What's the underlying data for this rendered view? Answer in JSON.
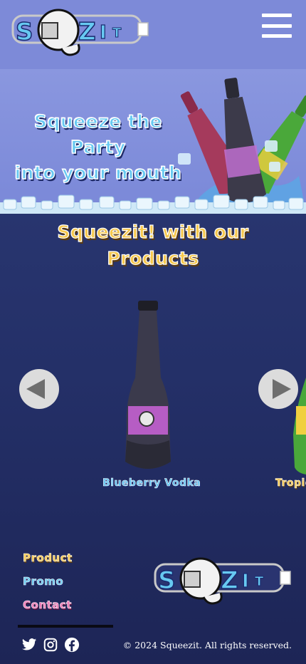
{
  "brand": {
    "logo_text": "SQZIT",
    "logo_icon": "squeeze-fist-bottle-logo"
  },
  "header": {
    "menu_icon": "hamburger-menu-icon"
  },
  "hero": {
    "title_line1": "Squeeze the Party",
    "title_line2": "into your mouth"
  },
  "products": {
    "title_line1": "Squeezit! with our",
    "title_line2": "Products",
    "items": [
      {
        "name": "Blueberry Vodka",
        "color": "#3a3240"
      },
      {
        "name": "Tropic",
        "color": "#3e8a2a"
      }
    ],
    "prev_icon": "arrow-left-icon",
    "next_icon": "arrow-right-icon"
  },
  "footer": {
    "links": {
      "product": "Product",
      "promo": "Promo",
      "contact": "Contact"
    },
    "social": [
      "twitter-icon",
      "instagram-icon",
      "facebook-icon"
    ],
    "copyright": "© 2024 Squeezit. All rights reserved."
  },
  "colors": {
    "header_bg": "#7d8ad8",
    "section_bg": "#243068",
    "accent_blue": "#67c9f1",
    "accent_yellow": "#f6c84d",
    "accent_pink": "#f07ab8"
  }
}
